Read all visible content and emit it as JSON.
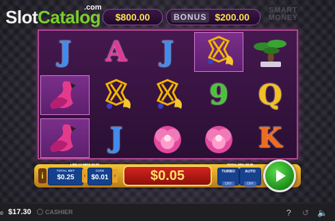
{
  "header": {
    "logo_slot": "Slot",
    "logo_catalog": "Catalog",
    "logo_com": ".com",
    "money": "$800.00",
    "bonus_word": "BONUS",
    "bonus_value": "$200.00",
    "smart_money": [
      "SMART",
      "MONEY"
    ]
  },
  "reels": {
    "symbols": [
      [
        "J",
        "A",
        "J",
        "knot-dragon",
        "bonsai"
      ],
      [
        "flamingo",
        "knot-dragon",
        "knot-dragon",
        "9",
        "Q"
      ],
      [
        "flamingo",
        "J",
        "peony",
        "peony",
        "K"
      ]
    ]
  },
  "controls": {
    "line_info": "LINE 17 WINS $0.05",
    "total_bet_label": "TOTAL BET",
    "total_bet": "$0.25",
    "coin_label": "COIN",
    "coin": "$0.01",
    "win_amount": "$0.05",
    "total_win_label": "TOTAL WIN: $0.05",
    "turbo_label": "TURBO",
    "turbo_state": "OFF",
    "auto_label": "AUTO",
    "auto_state": "OFF",
    "info_glyph": "i"
  },
  "footer": {
    "balance_label": "e",
    "balance": "$17.30",
    "cashier": "CASHIER",
    "help_glyph": "?",
    "history_glyph": "↺",
    "sound_glyph": "🔈"
  },
  "colors": {
    "accent_gold": "#f6c535",
    "reel_border": "#b0488f",
    "spin_green": "#1d8e1a",
    "logo_green": "#7ccf2a"
  }
}
